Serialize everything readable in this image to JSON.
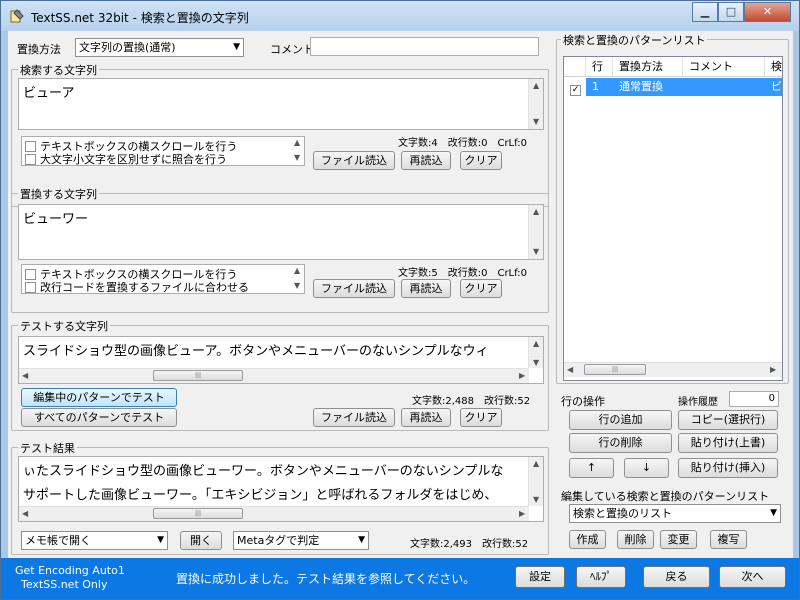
{
  "window": {
    "title": "TextSS.net 32bit - 検索と置換の文字列",
    "minimize": "▁",
    "maximize": "□",
    "close": "✕"
  },
  "replace_method": {
    "label": "置換方法",
    "selected": "文字列の置換(通常)",
    "comment_label": "コメント",
    "comment_value": ""
  },
  "search": {
    "title": "検索する文字列",
    "text": "ビューア",
    "options": [
      "テキストボックスの横スクロールを行う",
      "大文字小文字を区別せずに照合を行う"
    ],
    "stats": "文字数:4　改行数:0　CrLf:0",
    "load_button": "ファイル読込",
    "reload_button": "再読込",
    "clear_button": "クリア"
  },
  "replace": {
    "title": "置換する文字列",
    "text": "ビューワー",
    "options": [
      "テキストボックスの横スクロールを行う",
      "改行コードを置換するファイルに合わせる"
    ],
    "stats": "文字数:5　改行数:0　CrLf:0",
    "load_button": "ファイル読込",
    "reload_button": "再読込",
    "clear_button": "クリア"
  },
  "test_string": {
    "title": "テストする文字列",
    "text": "スライドショウ型の画像ビューア。ボタンやメニューバーのないシンプルなウィ",
    "test_editing_button": "編集中のパターンでテスト",
    "test_all_button": "すべてのパターンでテスト",
    "stats": "文字数:2,488　改行数:52",
    "load_button": "ファイル読込",
    "reload_button": "再読込",
    "clear_button": "クリア"
  },
  "test_result": {
    "title": "テスト結果",
    "lines": [
      "ぃたスライドショウ型の画像ビューワー。ボタンやメニューバーのないシンプルな",
      "サポートした画像ビューワー。「エキシビジョン」と呼ばれるフォルダをはじめ、"
    ],
    "open_with": "メモ帳で開く",
    "open_button": "開く",
    "judge_by": "Metaタグで判定",
    "stats": "文字数:2,493　改行数:52"
  },
  "pattern_list": {
    "title": "検索と置換のパターンリスト",
    "columns": [
      "行",
      "置換方法",
      "コメント",
      "検"
    ],
    "rows": [
      {
        "row": "1",
        "method": "通常置換",
        "comment": "",
        "extra": "ビ",
        "checked": true
      }
    ]
  },
  "row_ops": {
    "title": "行の操作",
    "history_label": "操作履歴",
    "history_value": "0",
    "add_row": "行の追加",
    "copy_selected": "コピー(選択行)",
    "delete_row": "行の削除",
    "paste_overwrite": "貼り付け(上書)",
    "move_up": "↑",
    "move_down": "↓",
    "paste_insert": "貼り付け(挿入)"
  },
  "editing_list": {
    "title": "編集している検索と置換のパターンリスト",
    "selected": "検索と置換のリスト",
    "create": "作成",
    "delete": "削除",
    "change": "変更",
    "duplicate": "複写"
  },
  "statusbar": {
    "encoding": "Get Encoding Auto1",
    "only": "TextSS.net Only",
    "message": "置換に成功しました。テスト結果を参照してください。",
    "settings": "設定",
    "help": "ﾍﾙﾌﾟ",
    "back": "戻る",
    "next": "次へ"
  },
  "colors": {
    "status_bar": "#0b78e3",
    "selection": "#3399ff",
    "window_frame": "#a9c8e6",
    "panel": "#f0f0f0"
  }
}
